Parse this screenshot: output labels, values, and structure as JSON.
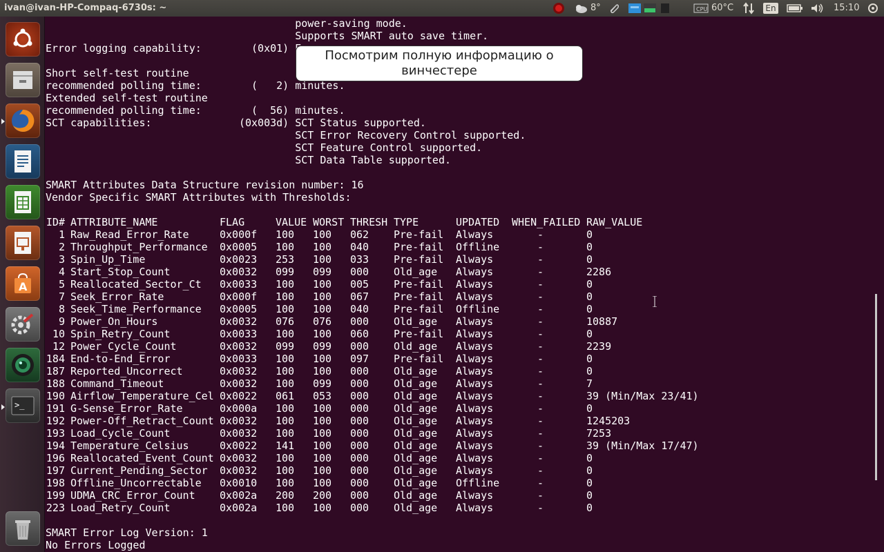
{
  "window": {
    "title": "ivan@ivan-HP-Compaq-6730s: ~"
  },
  "panel": {
    "weather": "8°",
    "temperature": "60°C",
    "keyboard_layout": "En",
    "clock": "15:10",
    "icons": [
      "record-icon",
      "weather-icon",
      "clip-icon",
      "network-blue-icon",
      "network-green-icon",
      "cpu-icon",
      "transfer-icon",
      "battery-icon",
      "volume-icon"
    ]
  },
  "launcher": {
    "items": [
      "ubuntu-dash",
      "file-manager",
      "firefox",
      "writer",
      "calc",
      "impress",
      "software-center",
      "system-settings",
      "webcam",
      "terminal",
      "trash"
    ]
  },
  "callout": {
    "text": "Посмотрим полную информацию о винчестере"
  },
  "terminal": {
    "pre_lines": [
      "                                        power-saving mode.",
      "                                        Supports SMART auto save timer.",
      "Error logging capability:        (0x01) E",
      "                                        G",
      "Short self-test routine",
      "recommended polling time:        (   2) minutes.",
      "Extended self-test routine",
      "recommended polling time:        (  56) minutes.",
      "SCT capabilities:              (0x003d) SCT Status supported.",
      "                                        SCT Error Recovery Control supported.",
      "                                        SCT Feature Control supported.",
      "                                        SCT Data Table supported.",
      "",
      "SMART Attributes Data Structure revision number: 16",
      "Vendor Specific SMART Attributes with Thresholds:"
    ],
    "table": {
      "headers": {
        "id": "ID#",
        "name": "ATTRIBUTE_NAME",
        "flag": "FLAG",
        "value": "VALUE",
        "worst": "WORST",
        "thresh": "THRESH",
        "type": "TYPE",
        "updated": "UPDATED",
        "when_failed": "WHEN_FAILED",
        "raw": "RAW_VALUE"
      },
      "rows": [
        [
          "1",
          "Raw_Read_Error_Rate",
          "0x000f",
          "100",
          "100",
          "062",
          "Pre-fail",
          "Always",
          "-",
          "0"
        ],
        [
          "2",
          "Throughput_Performance",
          "0x0005",
          "100",
          "100",
          "040",
          "Pre-fail",
          "Offline",
          "-",
          "0"
        ],
        [
          "3",
          "Spin_Up_Time",
          "0x0023",
          "253",
          "100",
          "033",
          "Pre-fail",
          "Always",
          "-",
          "0"
        ],
        [
          "4",
          "Start_Stop_Count",
          "0x0032",
          "099",
          "099",
          "000",
          "Old_age",
          "Always",
          "-",
          "2286"
        ],
        [
          "5",
          "Reallocated_Sector_Ct",
          "0x0033",
          "100",
          "100",
          "005",
          "Pre-fail",
          "Always",
          "-",
          "0"
        ],
        [
          "7",
          "Seek_Error_Rate",
          "0x000f",
          "100",
          "100",
          "067",
          "Pre-fail",
          "Always",
          "-",
          "0"
        ],
        [
          "8",
          "Seek_Time_Performance",
          "0x0005",
          "100",
          "100",
          "040",
          "Pre-fail",
          "Offline",
          "-",
          "0"
        ],
        [
          "9",
          "Power_On_Hours",
          "0x0032",
          "076",
          "076",
          "000",
          "Old_age",
          "Always",
          "-",
          "10887"
        ],
        [
          "10",
          "Spin_Retry_Count",
          "0x0033",
          "100",
          "100",
          "060",
          "Pre-fail",
          "Always",
          "-",
          "0"
        ],
        [
          "12",
          "Power_Cycle_Count",
          "0x0032",
          "099",
          "099",
          "000",
          "Old_age",
          "Always",
          "-",
          "2239"
        ],
        [
          "184",
          "End-to-End_Error",
          "0x0033",
          "100",
          "100",
          "097",
          "Pre-fail",
          "Always",
          "-",
          "0"
        ],
        [
          "187",
          "Reported_Uncorrect",
          "0x0032",
          "100",
          "100",
          "000",
          "Old_age",
          "Always",
          "-",
          "0"
        ],
        [
          "188",
          "Command_Timeout",
          "0x0032",
          "100",
          "099",
          "000",
          "Old_age",
          "Always",
          "-",
          "7"
        ],
        [
          "190",
          "Airflow_Temperature_Cel",
          "0x0022",
          "061",
          "053",
          "000",
          "Old_age",
          "Always",
          "-",
          "39 (Min/Max 23/41)"
        ],
        [
          "191",
          "G-Sense_Error_Rate",
          "0x000a",
          "100",
          "100",
          "000",
          "Old_age",
          "Always",
          "-",
          "0"
        ],
        [
          "192",
          "Power-Off_Retract_Count",
          "0x0032",
          "100",
          "100",
          "000",
          "Old_age",
          "Always",
          "-",
          "1245203"
        ],
        [
          "193",
          "Load_Cycle_Count",
          "0x0032",
          "100",
          "100",
          "000",
          "Old_age",
          "Always",
          "-",
          "7253"
        ],
        [
          "194",
          "Temperature_Celsius",
          "0x0022",
          "141",
          "100",
          "000",
          "Old_age",
          "Always",
          "-",
          "39 (Min/Max 17/47)"
        ],
        [
          "196",
          "Reallocated_Event_Count",
          "0x0032",
          "100",
          "100",
          "000",
          "Old_age",
          "Always",
          "-",
          "0"
        ],
        [
          "197",
          "Current_Pending_Sector",
          "0x0032",
          "100",
          "100",
          "000",
          "Old_age",
          "Always",
          "-",
          "0"
        ],
        [
          "198",
          "Offline_Uncorrectable",
          "0x0010",
          "100",
          "100",
          "000",
          "Old_age",
          "Offline",
          "-",
          "0"
        ],
        [
          "199",
          "UDMA_CRC_Error_Count",
          "0x002a",
          "200",
          "200",
          "000",
          "Old_age",
          "Always",
          "-",
          "0"
        ],
        [
          "223",
          "Load_Retry_Count",
          "0x002a",
          "100",
          "100",
          "000",
          "Old_age",
          "Always",
          "-",
          "0"
        ]
      ]
    },
    "post_lines": [
      "",
      "SMART Error Log Version: 1",
      "No Errors Logged"
    ]
  }
}
